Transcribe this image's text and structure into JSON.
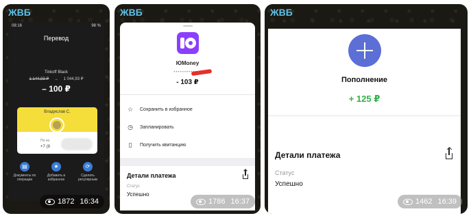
{
  "panel1": {
    "sender": "ЖВБ",
    "phone": {
      "status_time": "08:16",
      "status_battery": "98 %",
      "title": "Перевод",
      "account": "Tinkoff Black",
      "balance_before": "1 144,93 ₽",
      "balance_arrow": "→",
      "balance_after": "1 044,93 ₽",
      "amount": "– 100 ₽",
      "recipient": "Владислав С.",
      "phone_label": "По но",
      "phone_prefix": "+7 (9",
      "actions": [
        {
          "label": "Документы по операции",
          "icon": "document-icon"
        },
        {
          "label": "Добавить в избранное",
          "icon": "star-icon"
        },
        {
          "label": "Сделать регулярным",
          "icon": "repeat-icon"
        }
      ]
    },
    "views": "1872",
    "time": "16:34"
  },
  "panel2": {
    "sender": "ЖВБ",
    "service": "ЮMoney",
    "masked_account": "•••••••••••••",
    "amount": "- 103 ₽",
    "menu": [
      {
        "label": "Сохранить в избранное",
        "icon": "star-icon"
      },
      {
        "label": "Запланировать",
        "icon": "clock-icon"
      },
      {
        "label": "Получить квитанцию",
        "icon": "receipt-icon"
      }
    ],
    "details_title": "Детали платежа",
    "status_label": "Статус",
    "status_value": "Успешно",
    "views": "1786",
    "time": "16:37"
  },
  "panel3": {
    "sender": "ЖВБ",
    "service": "Пополнение",
    "amount": "+ 125 ₽",
    "details_title": "Детали платежа",
    "status_label": "Статус",
    "status_value": "Успешно",
    "views": "1462",
    "time": "16:39"
  },
  "colors": {
    "sender_name": "#5ec1e8",
    "amount_positive": "#33b04a",
    "yoomoney_brand": "#8b3ffd",
    "topup_icon": "#5c6fd6"
  }
}
